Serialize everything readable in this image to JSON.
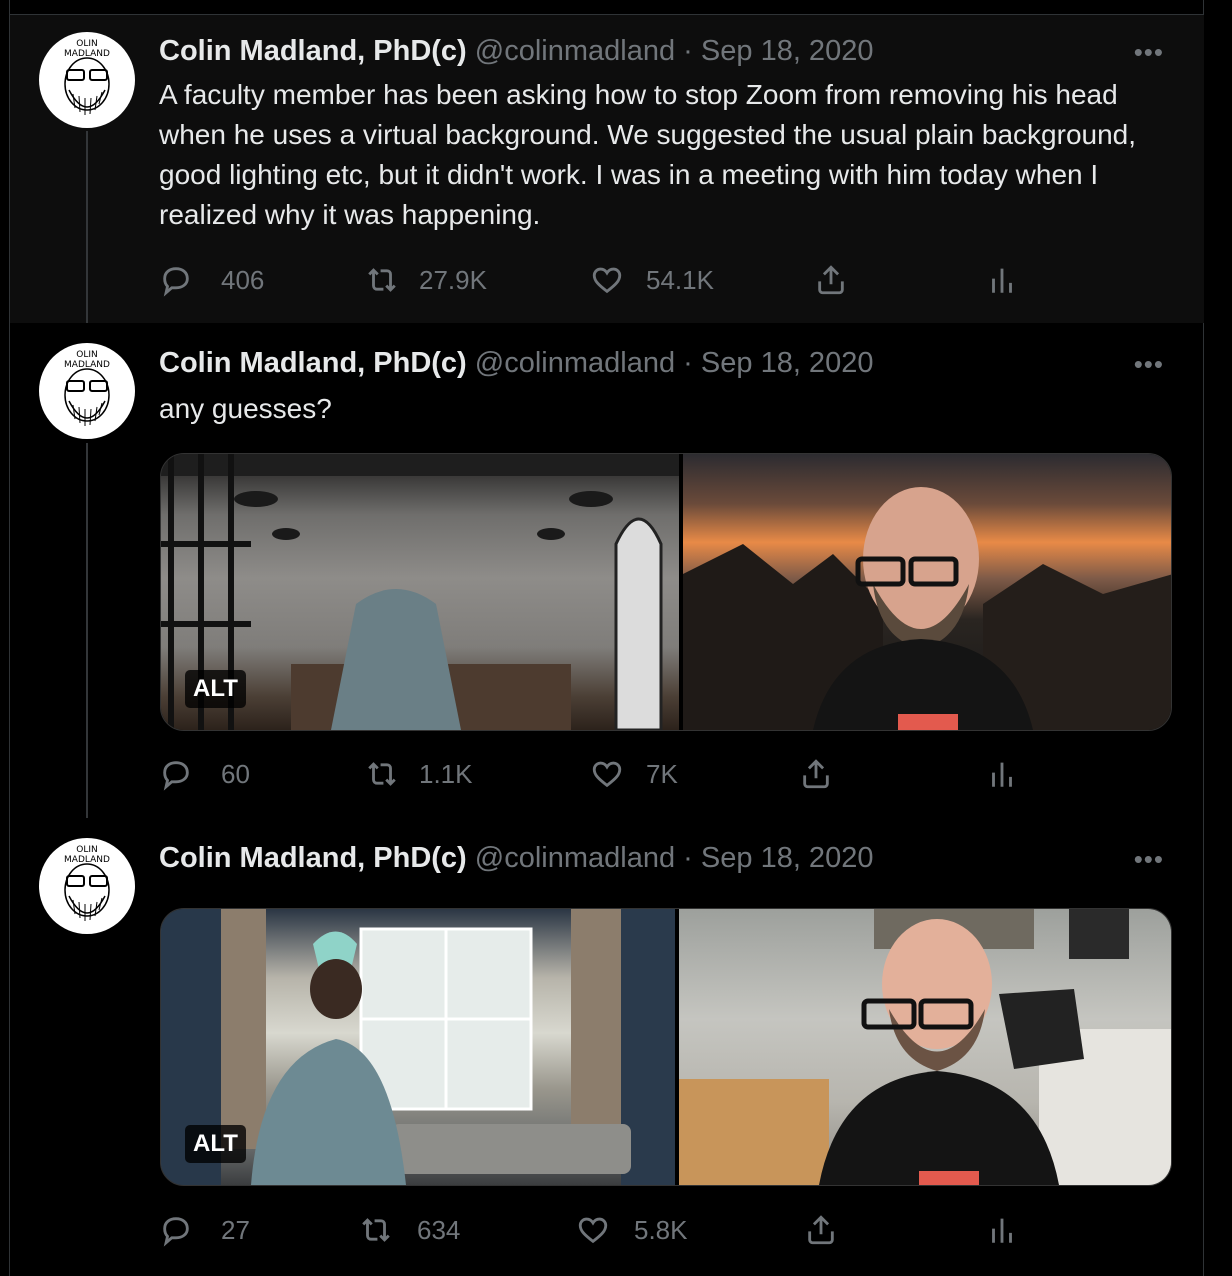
{
  "tweets": [
    {
      "name": "Colin Madland, PhD(c)",
      "handle": "@colinmadland",
      "date": "Sep 18, 2020",
      "text": "A faculty member has been asking how to stop Zoom from removing his head when he uses a virtual background. We suggested the usual plain background, good lighting etc, but it didn't work. I was in a meeting with him today when I realized why it was happening.",
      "replies": "406",
      "retweets": "27.9K",
      "likes": "54.1K"
    },
    {
      "name": "Colin Madland, PhD(c)",
      "handle": "@colinmadland",
      "date": "Sep 18, 2020",
      "text": "any guesses?",
      "alt_label": "ALT",
      "replies": "60",
      "retweets": "1.1K",
      "likes": "7K"
    },
    {
      "name": "Colin Madland, PhD(c)",
      "handle": "@colinmadland",
      "date": "Sep 18, 2020",
      "alt_label": "ALT",
      "replies": "27",
      "retweets": "634",
      "likes": "5.8K"
    }
  ],
  "avatar_text": {
    "top": "OLIN",
    "bottom": "MADLAND"
  },
  "more_glyph": "•••",
  "separator": "·",
  "icons": [
    "reply-icon",
    "retweet-icon",
    "like-icon",
    "share-icon",
    "analytics-icon",
    "more-icon"
  ],
  "colors": {
    "background": "#000000",
    "text": "#e7e9ea",
    "muted": "#71767b",
    "border": "#2f3336"
  }
}
